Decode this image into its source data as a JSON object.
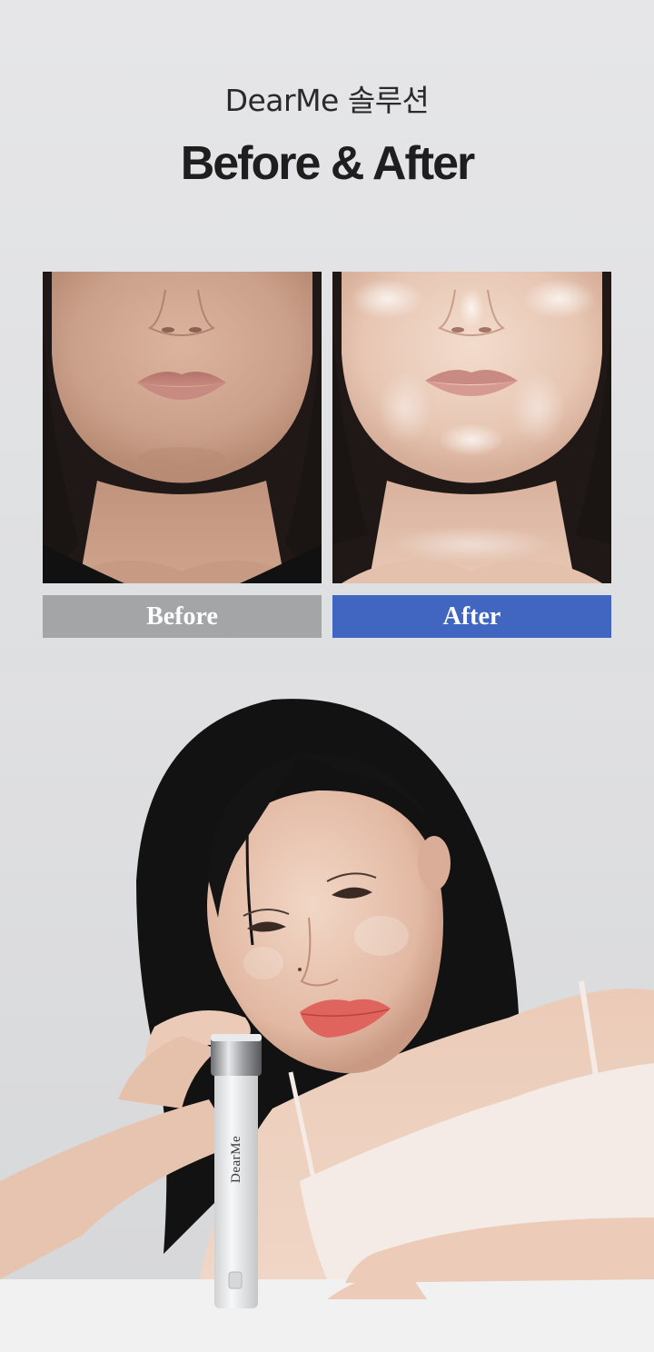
{
  "header": {
    "subtitle": "DearMe 솔루션",
    "title": "Before & After"
  },
  "comparison": {
    "before_label": "Before",
    "after_label": "After",
    "colors": {
      "before_bar": "#a4a5a6",
      "after_bar": "#4066c1"
    }
  },
  "product": {
    "brand_mark": "DearMe"
  }
}
